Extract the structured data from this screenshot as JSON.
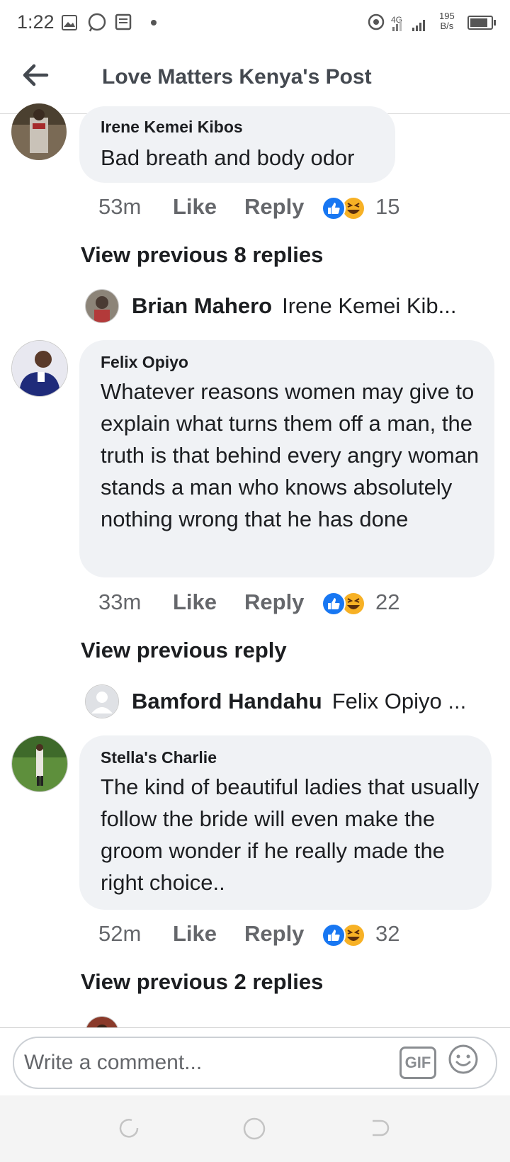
{
  "status_bar": {
    "time": "1:22",
    "network_type": "4G",
    "speed_value": "195",
    "speed_unit": "B/s"
  },
  "header": {
    "title": "Love Matters Kenya's Post"
  },
  "comments": [
    {
      "name": "Irene Kemei Kibos",
      "text": "Bad breath and body odor",
      "time": "53m",
      "like": "Like",
      "reply": "Reply",
      "reaction_count": "15",
      "view_previous": "View previous 8 replies",
      "reply_preview_name": "Brian Mahero",
      "reply_preview_text": "Irene Kemei Kib..."
    },
    {
      "name": "Felix Opiyo",
      "text": "Whatever reasons women may give to explain what turns them off a man, the truth is that behind every angry woman stands a man who knows absolutely nothing wrong that he has done",
      "time": "33m",
      "like": "Like",
      "reply": "Reply",
      "reaction_count": "22",
      "view_previous": "View previous reply",
      "reply_preview_name": "Bamford Handahu",
      "reply_preview_text": "Felix Opiyo ..."
    },
    {
      "name": "Stella's Charlie",
      "text": "The kind of beautiful ladies that usually follow the bride will even make the groom wonder if he really made the right choice..",
      "time": "52m",
      "like": "Like",
      "reply": "Reply",
      "reaction_count": "32",
      "view_previous": "View previous 2 replies"
    }
  ],
  "composer": {
    "placeholder": "Write a comment...",
    "gif_label": "GIF"
  },
  "colors": {
    "bubble": "#f0f2f5",
    "like_blue": "#1877f2",
    "haha_yellow": "#f7b125",
    "meta_gray": "#65676b"
  }
}
